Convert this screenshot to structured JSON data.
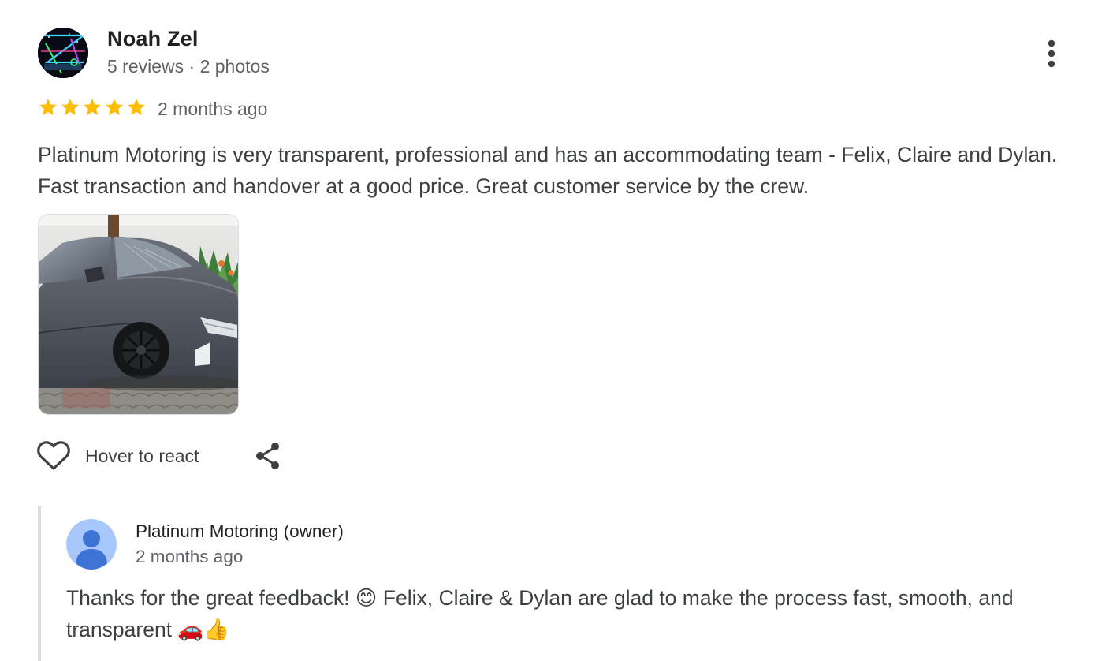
{
  "review": {
    "reviewer": {
      "name": "Noah Zel",
      "meta": "5 reviews · 2 photos",
      "avatar_icon": "avatar-image"
    },
    "more_icon": "more-vert-icon",
    "rating": {
      "stars": 5,
      "max": 5,
      "color": "#fbbc04"
    },
    "time": "2 months ago",
    "text": "Platinum Motoring is very transparent, professional and has an accommodating team - Felix, Claire and Dylan. Fast transaction and handover at a good price. Great customer service by the crew.",
    "photos": [
      {
        "subject": "grey sedan car photo"
      }
    ],
    "actions": {
      "react_label": "Hover to react",
      "react_icon": "heart-icon",
      "share_icon": "share-icon"
    }
  },
  "owner_reply": {
    "name": "Platinum Motoring (owner)",
    "time": "2 months ago",
    "avatar_icon": "default-user-icon",
    "text": "Thanks for the great feedback! 😊 Felix, Claire & Dylan are glad to make the process fast, smooth, and transparent 🚗👍"
  },
  "colors": {
    "primary_text": "#202124",
    "secondary_text": "#5f6368",
    "body_text": "#3c4043",
    "divider": "#dadce0",
    "star": "#fbbc04"
  }
}
